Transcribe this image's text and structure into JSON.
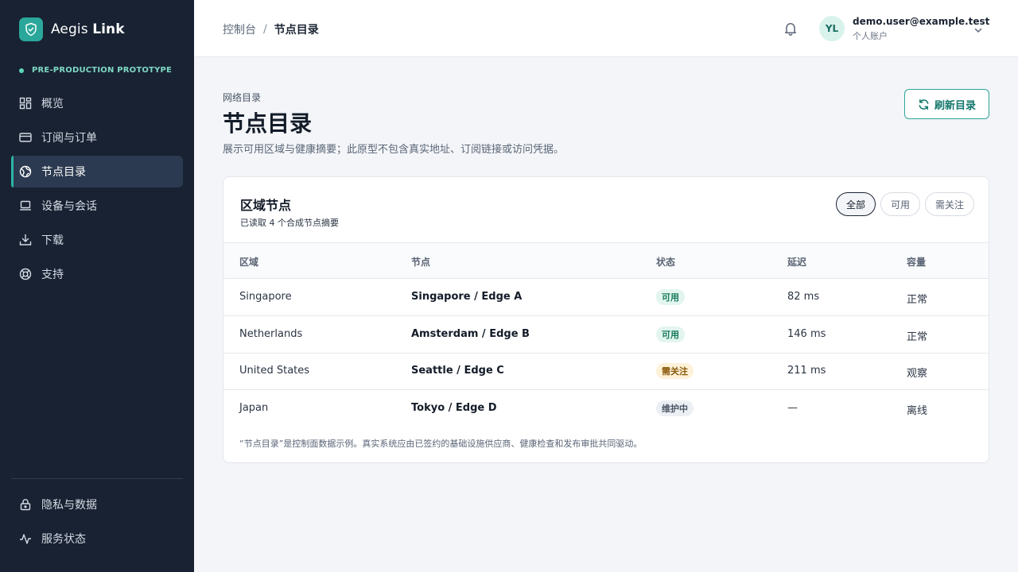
{
  "brand": {
    "name_prefix": "Aegis",
    "name_bold": "Link"
  },
  "environment": {
    "label": "PRE-PRODUCTION PROTOTYPE"
  },
  "nav": {
    "items": [
      {
        "label": "概览",
        "icon": "grid-icon"
      },
      {
        "label": "订阅与订单",
        "icon": "card-icon"
      },
      {
        "label": "节点目录",
        "icon": "globe-icon",
        "active": true
      },
      {
        "label": "设备与会话",
        "icon": "laptop-icon"
      },
      {
        "label": "下载",
        "icon": "download-icon"
      },
      {
        "label": "支持",
        "icon": "lifebuoy-icon"
      }
    ],
    "bottom": [
      {
        "label": "隐私与数据",
        "icon": "lock-icon"
      },
      {
        "label": "服务状态",
        "icon": "activity-icon"
      }
    ]
  },
  "breadcrumb": {
    "parent": "控制台",
    "separator": "/",
    "current": "节点目录"
  },
  "user": {
    "initials": "YL",
    "email": "demo.user@example.test",
    "role": "个人账户"
  },
  "header": {
    "eyebrow": "网络目录",
    "title": "节点目录",
    "description": "展示可用区域与健康摘要；此原型不包含真实地址、订阅链接或访问凭据。",
    "refresh_label": "刷新目录"
  },
  "card": {
    "title": "区域节点",
    "subtitle": "已读取 4 个合成节点摘要",
    "filters": [
      {
        "label": "全部",
        "active": true
      },
      {
        "label": "可用",
        "active": false
      },
      {
        "label": "需关注",
        "active": false
      }
    ],
    "columns": [
      "区域",
      "节点",
      "状态",
      "延迟",
      "容量"
    ],
    "rows": [
      {
        "region": "Singapore",
        "node": "Singapore / Edge A",
        "status": "可用",
        "status_type": "ok",
        "latency": "82 ms",
        "capacity": "正常"
      },
      {
        "region": "Netherlands",
        "node": "Amsterdam / Edge B",
        "status": "可用",
        "status_type": "ok",
        "latency": "146 ms",
        "capacity": "正常"
      },
      {
        "region": "United States",
        "node": "Seattle / Edge C",
        "status": "需关注",
        "status_type": "warn",
        "latency": "211 ms",
        "capacity": "观察"
      },
      {
        "region": "Japan",
        "node": "Tokyo / Edge D",
        "status": "维护中",
        "status_type": "maint",
        "latency": "—",
        "capacity": "离线"
      }
    ],
    "note": "“节点目录”是控制面数据示例。真实系统应由已签约的基础设施供应商、健康检查和发布审批共同驱动。"
  },
  "colors": {
    "sidebar_bg": "#182232",
    "accent": "#2aa79a",
    "ok": "#187a5e",
    "warn": "#8a5a0a"
  }
}
